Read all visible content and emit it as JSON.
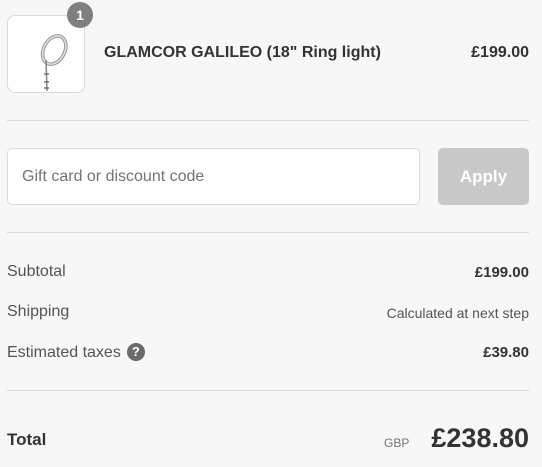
{
  "cart": {
    "items": [
      {
        "quantity": "1",
        "name": "GLAMCOR GALILEO (18\" Ring light)",
        "price": "£199.00",
        "image_icon": "ring-light-icon"
      }
    ]
  },
  "discount": {
    "placeholder": "Gift card or discount code",
    "value": "",
    "apply_label": "Apply"
  },
  "summary": {
    "subtotal_label": "Subtotal",
    "subtotal_value": "£199.00",
    "shipping_label": "Shipping",
    "shipping_value": "Calculated at next step",
    "taxes_label": "Estimated taxes",
    "taxes_help_icon": "?",
    "taxes_value": "£39.80",
    "total_label": "Total",
    "total_currency": "GBP",
    "total_value": "£238.80"
  },
  "colors": {
    "page_background": "#f7f7f7",
    "badge": "#7f7f7f",
    "apply_button_disabled": "#c8c8c8",
    "divider": "#d9d9d9"
  }
}
